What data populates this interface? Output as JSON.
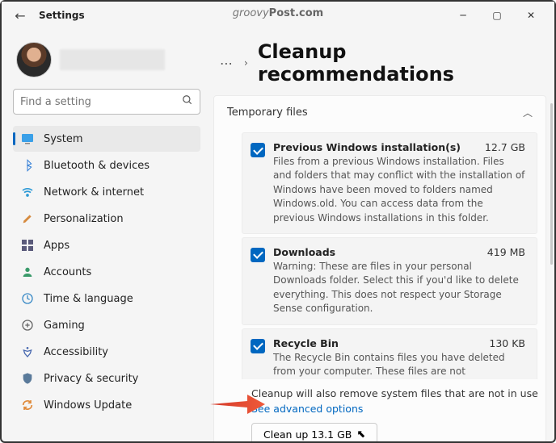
{
  "window": {
    "title": "Settings",
    "watermark_brand": "groovy",
    "watermark_suffix": "Post.com"
  },
  "search": {
    "placeholder": "Find a setting"
  },
  "nav": {
    "system": "System",
    "bluetooth": "Bluetooth & devices",
    "network": "Network & internet",
    "personalization": "Personalization",
    "apps": "Apps",
    "accounts": "Accounts",
    "time": "Time & language",
    "gaming": "Gaming",
    "accessibility": "Accessibility",
    "privacy": "Privacy & security",
    "update": "Windows Update"
  },
  "page": {
    "title": "Cleanup recommendations",
    "section_title": "Temporary files",
    "footer_note": "Cleanup will also remove system files that are not in use",
    "advanced_link": "See advanced options",
    "cleanup_button": "Clean up 13.1 GB"
  },
  "items": [
    {
      "title": "Previous Windows installation(s)",
      "size": "12.7 GB",
      "desc": "Files from a previous Windows installation.  Files and folders that may conflict with the installation of Windows have been moved to folders named Windows.old.  You can access data from the previous Windows installations in this folder."
    },
    {
      "title": "Downloads",
      "size": "419 MB",
      "desc": "Warning: These are files in your personal Downloads folder. Select this if you'd like to delete everything. This does not respect your Storage Sense configuration."
    },
    {
      "title": "Recycle Bin",
      "size": "130 KB",
      "desc": "The Recycle Bin contains files you have deleted from your computer. These files are not permanently removed until you empty the Recycle Bin."
    }
  ]
}
